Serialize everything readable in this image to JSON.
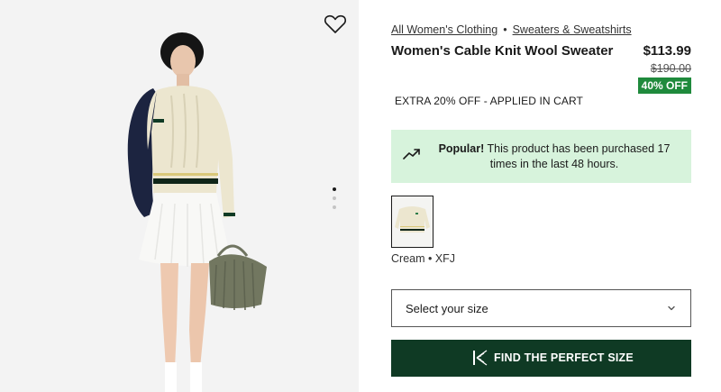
{
  "breadcrumb": {
    "items": [
      "All Women's Clothing",
      "Sweaters & Sweatshirts"
    ],
    "separator": "•"
  },
  "product": {
    "title": "Women's Cable Knit Wool Sweater",
    "price": "$113.99",
    "original_price": "$190.00",
    "discount_badge": "40% OFF",
    "extra_offer": "EXTRA 20% OFF - APPLIED IN CART"
  },
  "popular": {
    "heading": "Popular!",
    "text": "This product has been purchased 17 times in the last 48 hours.",
    "icon": "trending-up-icon"
  },
  "color": {
    "label": "Cream • XFJ"
  },
  "size": {
    "placeholder": "Select your size"
  },
  "fit_button": {
    "label": "FIND THE PERFECT SIZE",
    "icon": "k-logo-icon"
  },
  "gallery": {
    "slides": 3,
    "active_slide": 1
  },
  "colors": {
    "discount_bg": "#1f8a3c",
    "popular_bg": "#d7f3dc",
    "button_bg": "#0f3a24"
  }
}
